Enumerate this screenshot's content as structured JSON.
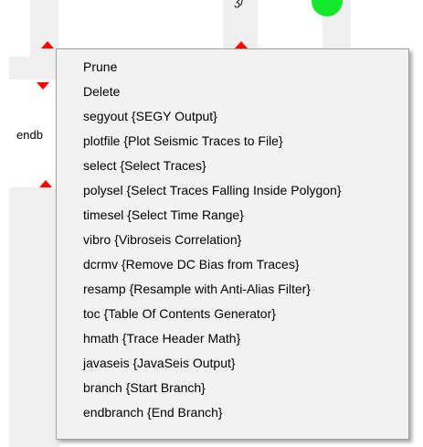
{
  "background": {
    "node_partial_label": "endb",
    "node_top_label": "ʒ/"
  },
  "colors": {
    "port_red": "#ff0000",
    "port_green": "#13e82a",
    "lane_gray": "#efefef",
    "menu_bg": "#f2f2f2"
  },
  "context_menu": {
    "items": [
      {
        "label": "Prune"
      },
      {
        "label": "Delete"
      },
      {
        "label": "segyout {SEGY Output}"
      },
      {
        "label": "plotfile {Plot Seismic Traces to File}"
      },
      {
        "label": "select {Select Traces}"
      },
      {
        "label": "polysel {Select Traces Falling Inside Polygon}"
      },
      {
        "label": "timesel {Select Time Range}"
      },
      {
        "label": "vibro {Vibroseis Correlation}"
      },
      {
        "label": "dcrmv {Remove DC Bias from Traces}"
      },
      {
        "label": "resamp {Resample with Anti-Alias Filter}"
      },
      {
        "label": "toc {Table Of Contents Generator}"
      },
      {
        "label": "hmath {Trace Header Math}"
      },
      {
        "label": "javaseis {JavaSeis Output}"
      },
      {
        "label": "branch {Start Branch}"
      },
      {
        "label": "endbranch {End Branch}"
      }
    ]
  }
}
